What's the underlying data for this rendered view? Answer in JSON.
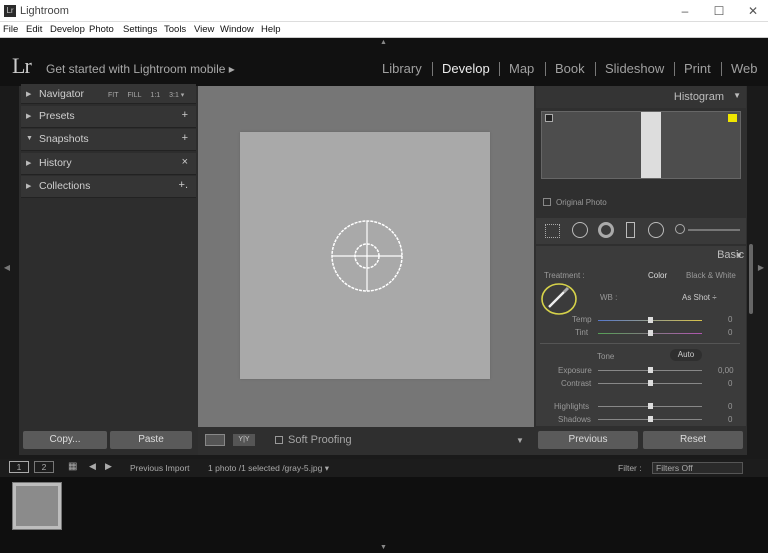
{
  "window": {
    "title": "Lightroom",
    "app_icon": "Lr",
    "min": "–",
    "max": "☐",
    "close": "✕"
  },
  "menu": [
    "File",
    "Edit",
    "Develop",
    "Photo",
    "Settings",
    "Tools",
    "View",
    "Window",
    "Help"
  ],
  "header": {
    "logo": "Lr",
    "mobile": "Get started with Lightroom mobile ▸",
    "modules": [
      "Library",
      "Develop",
      "Map",
      "Book",
      "Slideshow",
      "Print",
      "Web"
    ],
    "active_module": "Develop"
  },
  "left_panel": {
    "navigator": {
      "label": "Navigator",
      "options": [
        "FIT",
        "FILL",
        "1:1",
        "3:1 ▾"
      ]
    },
    "items": [
      {
        "label": "Presets",
        "action": "+"
      },
      {
        "label": "Snapshots",
        "action": "+"
      },
      {
        "label": "History",
        "action": "×"
      },
      {
        "label": "Collections",
        "action": "+."
      }
    ],
    "copy": "Copy...",
    "paste": "Paste"
  },
  "toolbar": {
    "soft_proofing": "Soft Proofing",
    "view_label": "Y|Y"
  },
  "right_panel": {
    "histogram": "Histogram",
    "original_photo": "Original Photo",
    "basic": "Basic",
    "treatment_label": "Treatment :",
    "treatment_color": "Color",
    "treatment_bw": "Black & White",
    "wb_label": "WB :",
    "wb_value": "As Shot ÷",
    "temp": {
      "label": "Temp",
      "value": "0"
    },
    "tint": {
      "label": "Tint",
      "value": "0"
    },
    "tone_label": "Tone",
    "auto": "Auto",
    "exposure": {
      "label": "Exposure",
      "value": "0,00"
    },
    "contrast": {
      "label": "Contrast",
      "value": "0"
    },
    "highlights": {
      "label": "Highlights",
      "value": "0"
    },
    "shadows": {
      "label": "Shadows",
      "value": "0"
    },
    "previous": "Previous",
    "reset": "Reset"
  },
  "filmstrip": {
    "page1": "1",
    "page2": "2",
    "source": "Previous Import",
    "info": "1 photo /1 selected /gray-5.jpg ▾",
    "filter_label": "Filter :",
    "filter_value": "Filters Off"
  },
  "colors": {
    "accent": "#d6d24a",
    "bg": "#1a1a1a",
    "panel": "#2f2f2f"
  }
}
